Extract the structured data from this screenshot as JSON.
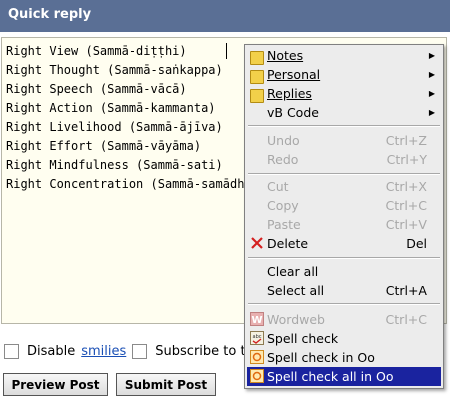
{
  "header": {
    "title": "Quick reply"
  },
  "editor": {
    "lines": [
      "Right View (Sammā-diṭṭhi)",
      "Right Thought (Sammā-saṅkappa)",
      "Right Speech (Sammā-vācā)",
      "Right Action (Sammā-kammanta)",
      "Right Livelihood (Sammā-ājīva)",
      "Right Effort (Sammā-vāyāma)",
      "Right Mindfulness (Sammā-sati)",
      "Right Concentration (Sammā-samādhi)"
    ]
  },
  "options": {
    "disable_label": "Disable",
    "smilies_link": "smilies",
    "subscribe_label": "Subscribe to t"
  },
  "buttons": {
    "preview": "Preview Post",
    "submit": "Submit Post"
  },
  "context_menu": {
    "notes": "Notes",
    "personal": "Personal",
    "replies": "Replies",
    "vbcode": "vB Code",
    "undo": "Undo",
    "undo_sc": "Ctrl+Z",
    "redo": "Redo",
    "redo_sc": "Ctrl+Y",
    "cut": "Cut",
    "cut_sc": "Ctrl+X",
    "copy": "Copy",
    "copy_sc": "Ctrl+C",
    "paste": "Paste",
    "paste_sc": "Ctrl+V",
    "delete": "Delete",
    "delete_sc": "Del",
    "clear_all": "Clear all",
    "select_all": "Select all",
    "select_all_sc": "Ctrl+A",
    "wordweb": "Wordweb",
    "wordweb_sc": "Ctrl+C",
    "spell_check": "Spell check",
    "spell_check_in_oo": "Spell check in Oo",
    "spell_check_all_in_oo": "Spell check all in Oo"
  },
  "colors": {
    "header_bg": "#5a6f95",
    "selection": "#1a239f",
    "editor_bg": "#fffef0"
  }
}
